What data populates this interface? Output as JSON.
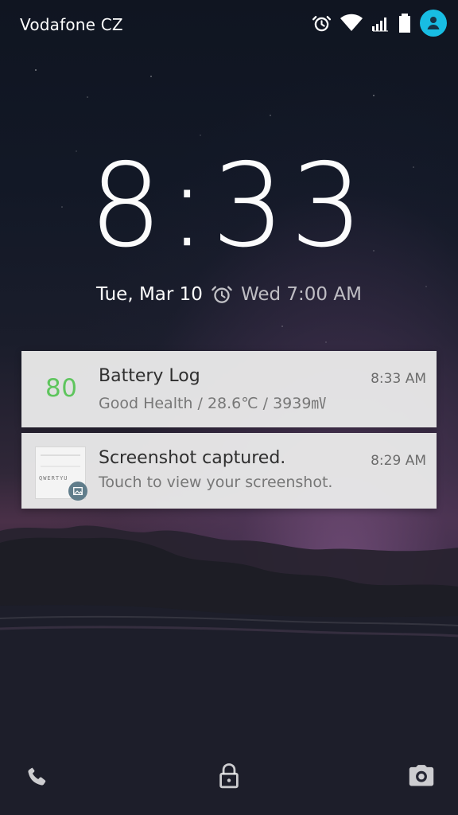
{
  "status_bar": {
    "carrier": "Vodafone CZ",
    "icons": [
      "alarm-icon",
      "wifi-icon",
      "signal-icon",
      "battery-icon",
      "user-icon"
    ],
    "accent": "#18BDE3"
  },
  "lock_screen": {
    "time": "8:33",
    "date": "Tue, Mar 10",
    "next_alarm": "Wed 7:00 AM"
  },
  "notifications": [
    {
      "app_icon_value": "80",
      "title": "Battery Log",
      "body": "Good Health / 28.6℃ / 3939㎷",
      "time": "8:33 AM",
      "accent": "#5EC55D"
    },
    {
      "thumbnail_keys": "QWERTYU",
      "title": "Screenshot captured.",
      "body": "Touch to view your screenshot.",
      "time": "8:29 AM",
      "badge_color": "#607D8B"
    }
  ],
  "bottom_actions": [
    "phone-icon",
    "unlock-icon",
    "camera-icon"
  ]
}
